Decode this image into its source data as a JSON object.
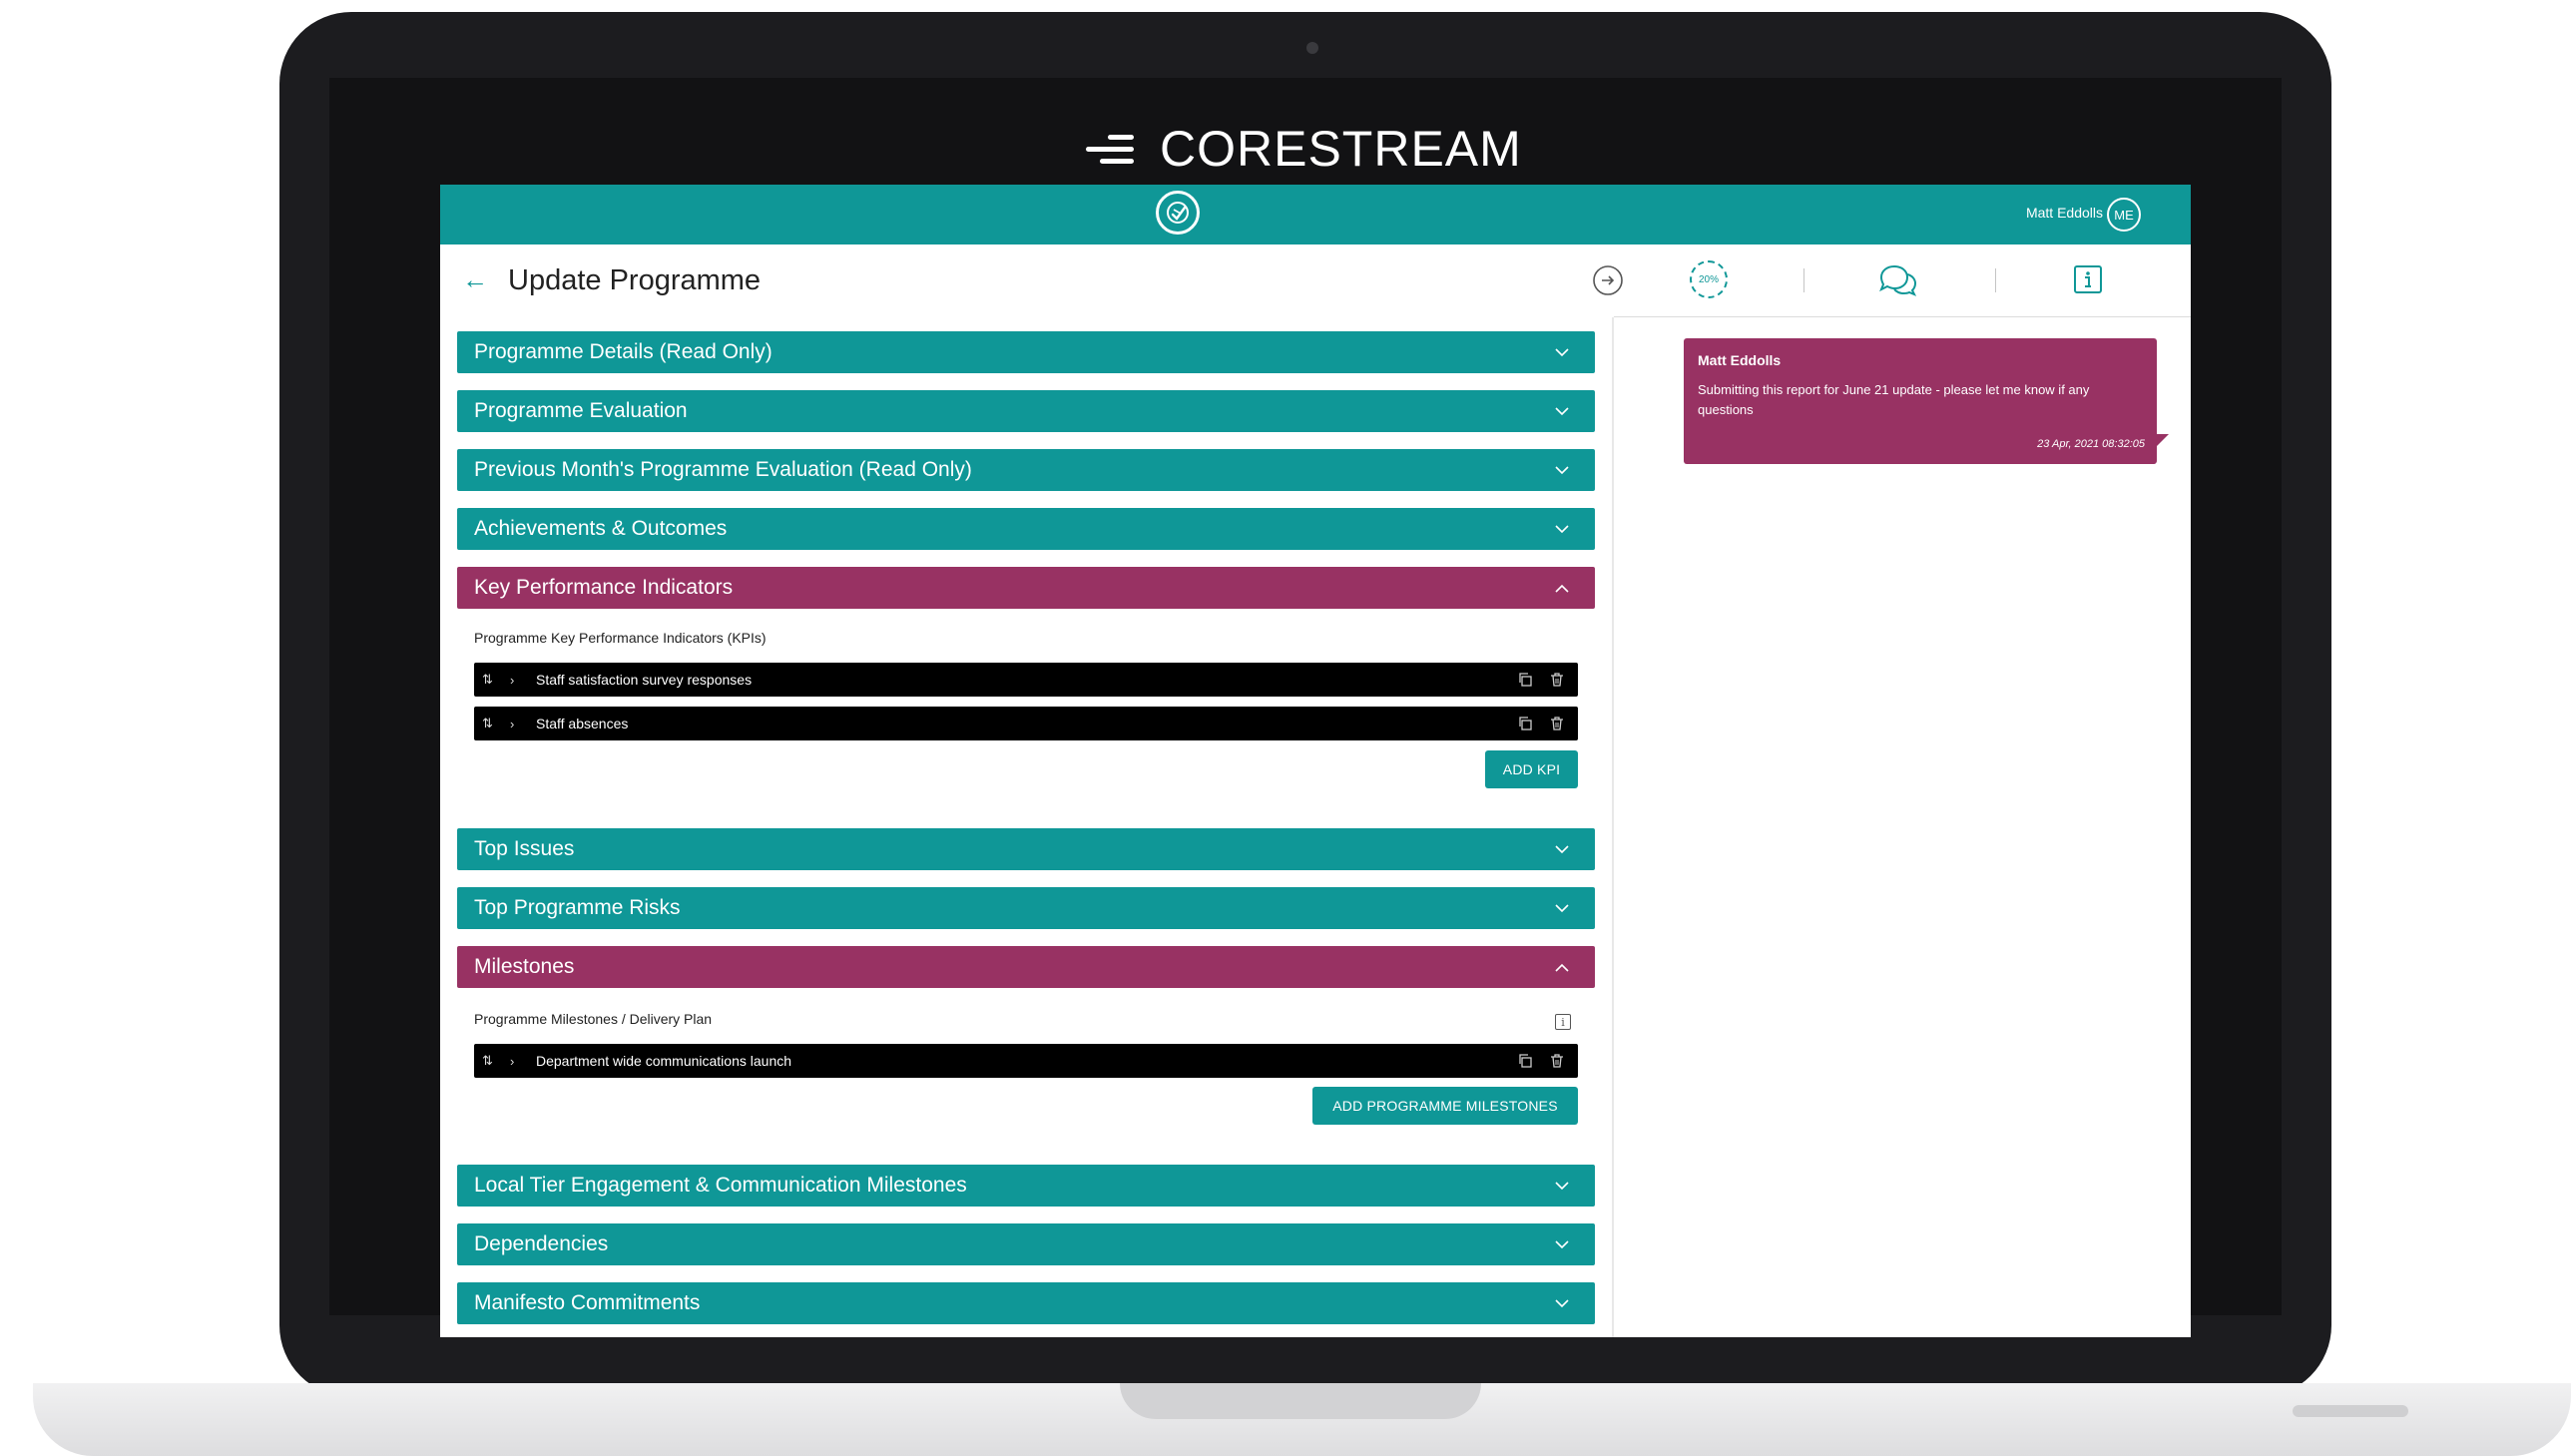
{
  "brand": {
    "name": "CORESTREAM"
  },
  "topbar": {
    "user_name": "Matt Eddolls",
    "user_initials": "ME"
  },
  "page": {
    "title": "Update Programme"
  },
  "toolbar": {
    "progress": "20%"
  },
  "sections": [
    {
      "label": "Programme Details (Read Only)"
    },
    {
      "label": "Programme Evaluation"
    },
    {
      "label": "Previous Month's Programme Evaluation (Read Only)"
    },
    {
      "label": "Achievements & Outcomes"
    },
    {
      "label": "Key Performance Indicators",
      "expanded": true
    },
    {
      "label": "Top Issues"
    },
    {
      "label": "Top Programme Risks"
    },
    {
      "label": "Milestones",
      "expanded": true
    },
    {
      "label": "Local Tier Engagement & Communication Milestones"
    },
    {
      "label": "Dependencies"
    },
    {
      "label": "Manifesto Commitments"
    }
  ],
  "kpis": {
    "heading": "Programme Key Performance Indicators (KPIs)",
    "items": [
      {
        "label": "Staff satisfaction survey responses"
      },
      {
        "label": "Staff absences"
      }
    ],
    "add_label": "ADD KPI"
  },
  "milestones": {
    "heading": "Programme Milestones / Delivery Plan",
    "items": [
      {
        "label": "Department wide communications launch"
      }
    ],
    "add_label": "ADD PROGRAMME MILESTONES"
  },
  "comment": {
    "author": "Matt Eddolls",
    "text": "Submitting this report for June 21 update - please let me know if any questions",
    "timestamp": "23 Apr, 2021 08:32:05"
  },
  "colors": {
    "teal": "#0f9797",
    "plum": "#983263",
    "frame": "#1c1c1f"
  }
}
